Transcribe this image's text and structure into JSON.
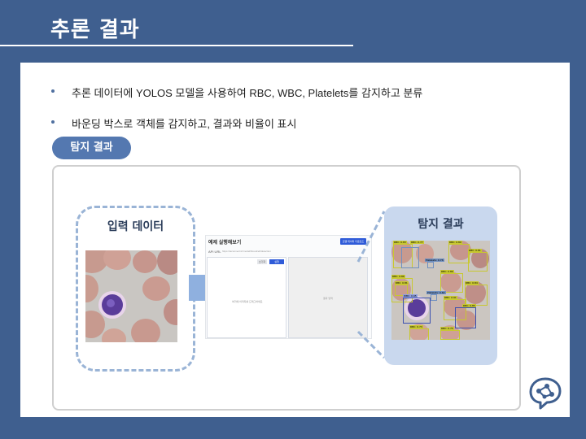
{
  "slide": {
    "title": "추론 결과",
    "bullets": [
      "추론 데이터에 YOLOS 모델을 사용하여 RBC, WBC, Platelets를 감지하고 분류",
      "바운딩 박스로 객체를 감지하고, 결과와 비율이 표시"
    ],
    "section_pill": "탐지 결과",
    "input_label": "입력 데이터",
    "detection_label": "탐지 결과"
  },
  "app_screenshot": {
    "title": "예제 실행해보기",
    "header_button": "모델 데이터 다운로드",
    "url_label": "API URL",
    "url_value": "https://aiconnect.kr/model/bloodcell/detection",
    "reset_button": "초기화",
    "run_button": "실행",
    "left_hint": "여기에 이미지를 드래그하세요",
    "right_hint": "결과 영역"
  },
  "detections": [
    {
      "label": "RBC: 0.83"
    },
    {
      "label": "RBC: 0.77"
    },
    {
      "label": "RBC: 0.80"
    },
    {
      "label": "RBC: 0.81"
    },
    {
      "label": "Platelets: 0.76"
    },
    {
      "label": "RBC: 0.86"
    },
    {
      "label": "RBC: 0.86"
    },
    {
      "label": "RBC: 0.84"
    },
    {
      "label": "RBC: 0.81"
    },
    {
      "label": "Platelets: 0.62"
    },
    {
      "label": "WBC: 0.95"
    },
    {
      "label": "RBC: 0.91"
    },
    {
      "label": "RBC: 0.73"
    },
    {
      "label": "RBC: 0.85"
    },
    {
      "label": "RBC: 0.75"
    }
  ],
  "colors": {
    "background": "#3f5f8f",
    "pill": "#5478b0",
    "detection_panel": "#c9d8ee",
    "dashed_border": "#9ab4d6",
    "rbc_box": "#c8c830",
    "wbc_box": "#3a4fb0",
    "platelet_box": "#7090c0"
  },
  "icons": {
    "bullet": "bullet-dot",
    "arrow": "right-arrow-icon",
    "logo": "brain-network-logo-icon"
  }
}
